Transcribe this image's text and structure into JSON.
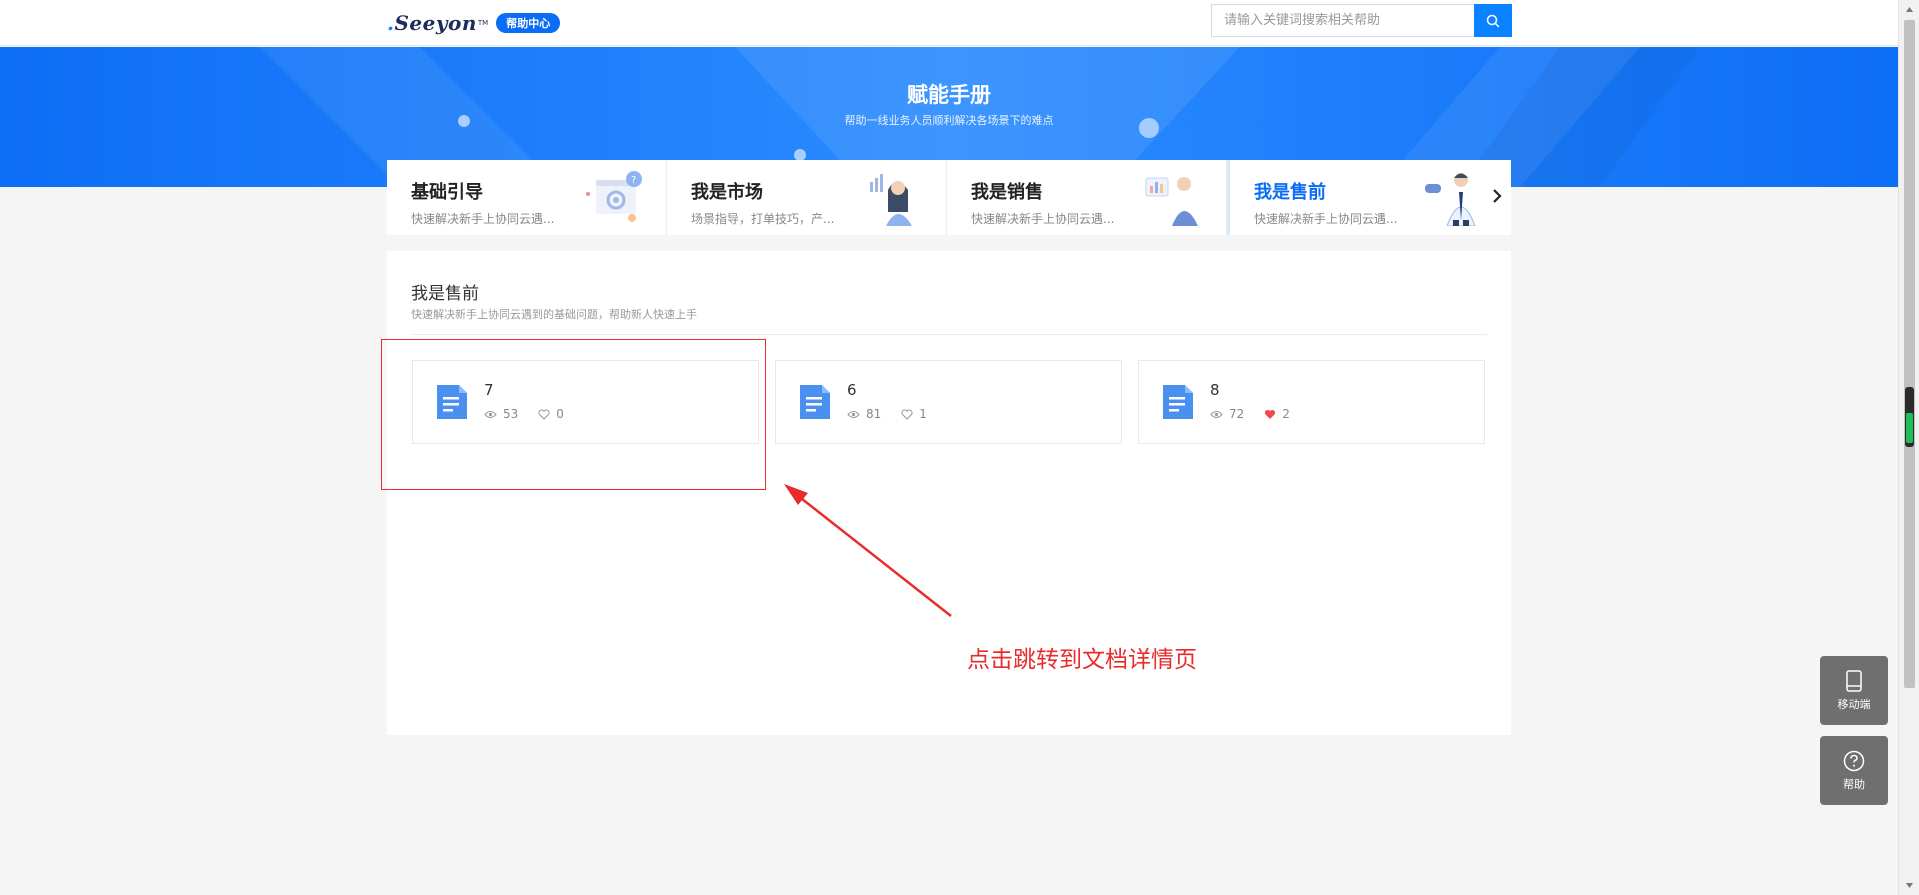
{
  "header": {
    "logo_text": "Seeyon",
    "logo_tm": "TM",
    "badge": "帮助中心",
    "search_placeholder": "请输入关键词搜索相关帮助",
    "search_icon": "search-icon"
  },
  "banner": {
    "title": "赋能手册",
    "subtitle": "帮助一线业务人员顺利解决各场景下的难点"
  },
  "categories": [
    {
      "title": "基础引导",
      "desc": "快速解决新手上协同云遇...",
      "icon": "gear-question-illustration",
      "active": false
    },
    {
      "title": "我是市场",
      "desc": "场景指导，打单技巧，产...",
      "icon": "marketer-illustration",
      "active": false
    },
    {
      "title": "我是销售",
      "desc": "快速解决新手上协同云遇...",
      "icon": "salesperson-illustration",
      "active": false
    },
    {
      "title": "我是售前",
      "desc": "快速解决新手上协同云遇...",
      "icon": "presales-illustration",
      "active": true
    }
  ],
  "panel": {
    "title": "我是售前",
    "desc": "快速解决新手上协同云遇到的基础问题，帮助新人快速上手",
    "docs": [
      {
        "name": "7",
        "views": "53",
        "likes": "0",
        "liked": false
      },
      {
        "name": "6",
        "views": "81",
        "likes": "1",
        "liked": false
      },
      {
        "name": "8",
        "views": "72",
        "likes": "2",
        "liked": true
      }
    ]
  },
  "annotation": {
    "text": "点击跳转到文档详情页",
    "color": "#e82b2b"
  },
  "floating": {
    "mobile_label": "移动端",
    "help_label": "帮助"
  },
  "colors": {
    "primary": "#0b82ff",
    "banner": "#0d6ef6",
    "liked_heart": "#f04a4a"
  }
}
